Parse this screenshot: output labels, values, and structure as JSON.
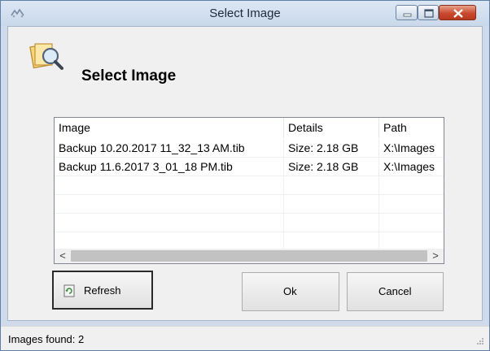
{
  "window": {
    "title": "Select Image"
  },
  "header": {
    "title": "Select Image"
  },
  "listview": {
    "columns": [
      "Image",
      "Details",
      "Path"
    ],
    "rows": [
      [
        "Backup 10.20.2017 11_32_13 AM.tib",
        "Size: 2.18 GB",
        "X:\\Images"
      ],
      [
        "Backup 11.6.2017 3_01_18 PM.tib",
        "Size: 2.18 GB",
        "X:\\Images"
      ]
    ],
    "scroll_left": "<",
    "scroll_right": ">"
  },
  "buttons": {
    "refresh": "Refresh",
    "ok": "Ok",
    "cancel": "Cancel"
  },
  "status": {
    "text": "Images found: 2"
  },
  "colors": {
    "frame": "#cfdbea",
    "close_button": "#c84a2f",
    "client": "#f0f0f0"
  },
  "icons": {
    "app": "app-icon",
    "header": "image-search-icon",
    "refresh": "refresh-icon"
  }
}
